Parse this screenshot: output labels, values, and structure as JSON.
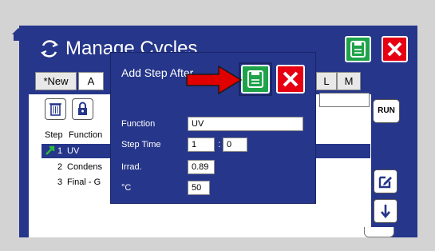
{
  "window": {
    "title": "Manage Cycles",
    "tabs": [
      "*New",
      "A",
      "L",
      "M"
    ]
  },
  "list": {
    "headers": {
      "step": "Step",
      "function": "Function"
    },
    "rows": [
      {
        "step": "1",
        "function": "UV",
        "selected": true
      },
      {
        "step": "2",
        "function": "Condens"
      },
      {
        "step": "3",
        "function": "Final - G"
      }
    ]
  },
  "buttons": {
    "run": "RUN",
    "colon": ":"
  },
  "dialog": {
    "title": "Add Step After",
    "function_label": "Function",
    "function_value": "UV",
    "step_time_label": "Step Time",
    "step_time_min": "1",
    "step_time_sec": "0",
    "irrad_label": "Irrad.",
    "irrad_value": "0.89",
    "temp_label": "°C",
    "temp_value": "50"
  },
  "colors": {
    "navy": "#26368a",
    "save_green": "#1fa34a",
    "close_red": "#e60012",
    "arrow_red": "#e00000"
  }
}
